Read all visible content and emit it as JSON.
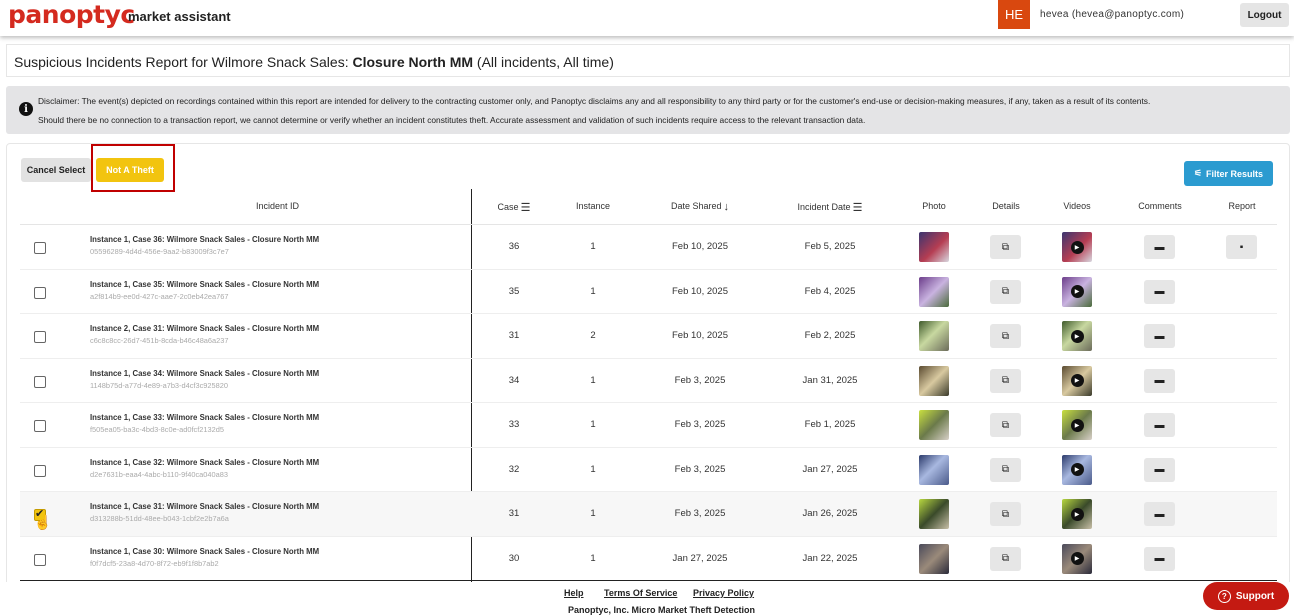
{
  "app": {
    "logo": "panoptyc",
    "tagline": "market assistant",
    "avatar_initials": "HE",
    "user": "hevea (hevea@panoptyc.com)",
    "logout": "Logout"
  },
  "report": {
    "prefix": "Suspicious Incidents Report for Wilmore Snack Sales: ",
    "location": "Closure North MM",
    "suffix": " (All incidents, All time)"
  },
  "disclaimer": {
    "line1": "Disclaimer: The event(s) depicted on recordings contained within this report are intended for delivery to the contracting customer only, and Panoptyc disclaims any and all responsibility to any third party or for the customer's end-use or decision-making measures, if any, taken as a result of its contents.",
    "line2": "Should there be no connection to a transaction report, we cannot determine or verify whether an incident constitutes theft. Accurate assessment and validation of such incidents require access to the relevant transaction data."
  },
  "toolbar": {
    "cancel_select": "Cancel Select",
    "not_a_theft": "Not A Theft",
    "filter_results": "Filter Results"
  },
  "columns": {
    "incident_id": "Incident ID",
    "case": "Case",
    "instance": "Instance",
    "date_shared": "Date Shared",
    "incident_date": "Incident Date",
    "photo": "Photo",
    "details": "Details",
    "videos": "Videos",
    "comments": "Comments",
    "report": "Report"
  },
  "rows": [
    {
      "title": "Instance 1, Case 36: Wilmore Snack Sales - Closure North MM",
      "uuid": "05596289-4d4d-456e-9aa2-b83009f3c7e7",
      "case": "36",
      "instance": "1",
      "date_shared": "Feb 10, 2025",
      "incident_date": "Feb 5, 2025",
      "checked": false,
      "has_report": true
    },
    {
      "title": "Instance 1, Case 35: Wilmore Snack Sales - Closure North MM",
      "uuid": "a2f814b9-ee0d-427c-aae7-2c0eb42ea767",
      "case": "35",
      "instance": "1",
      "date_shared": "Feb 10, 2025",
      "incident_date": "Feb 4, 2025",
      "checked": false,
      "has_report": false
    },
    {
      "title": "Instance 2, Case 31: Wilmore Snack Sales - Closure North MM",
      "uuid": "c6c8c8cc-26d7-451b-8cda-b46c48a6a237",
      "case": "31",
      "instance": "2",
      "date_shared": "Feb 10, 2025",
      "incident_date": "Feb 2, 2025",
      "checked": false,
      "has_report": false
    },
    {
      "title": "Instance 1, Case 34: Wilmore Snack Sales - Closure North MM",
      "uuid": "1148b75d-a77d-4e89-a7b3-d4cf3c925820",
      "case": "34",
      "instance": "1",
      "date_shared": "Feb 3, 2025",
      "incident_date": "Jan 31, 2025",
      "checked": false,
      "has_report": false
    },
    {
      "title": "Instance 1, Case 33: Wilmore Snack Sales - Closure North MM",
      "uuid": "f505ea05-ba3c-4bd3-8c0e-ad0fcf2132d5",
      "case": "33",
      "instance": "1",
      "date_shared": "Feb 3, 2025",
      "incident_date": "Feb 1, 2025",
      "checked": false,
      "has_report": false
    },
    {
      "title": "Instance 1, Case 32: Wilmore Snack Sales - Closure North MM",
      "uuid": "d2e7631b-eaa4-4abc-b110-9f40ca040a83",
      "case": "32",
      "instance": "1",
      "date_shared": "Feb 3, 2025",
      "incident_date": "Jan 27, 2025",
      "checked": false,
      "has_report": false
    },
    {
      "title": "Instance 1, Case 31: Wilmore Snack Sales - Closure North MM",
      "uuid": "d313288b-51dd-48ee-b043-1cbf2e2b7a6a",
      "case": "31",
      "instance": "1",
      "date_shared": "Feb 3, 2025",
      "incident_date": "Jan 26, 2025",
      "checked": true,
      "has_report": false
    },
    {
      "title": "Instance 1, Case 30: Wilmore Snack Sales - Closure North MM",
      "uuid": "f0f7dcf5-23a8-4d70-8f72-eb9f1f8b7ab2",
      "case": "30",
      "instance": "1",
      "date_shared": "Jan 27, 2025",
      "incident_date": "Jan 22, 2025",
      "checked": false,
      "has_report": false
    }
  ],
  "footer": {
    "help": "Help",
    "terms": "Terms Of Service",
    "privacy": "Privacy Policy",
    "copyright": "Panoptyc, Inc. Micro Market Theft Detection",
    "support": "Support"
  },
  "colors": {
    "brand": "#d42a1f",
    "accent_yellow": "#f2c40f",
    "filter_blue": "#2b9bd0",
    "support_red": "#c41a12"
  },
  "icons": {
    "details": "open-external-icon",
    "comments": "comment-icon",
    "report": "report-icon",
    "video": "play-icon",
    "sort": "sort-icon",
    "sort_desc": "arrow-down-icon",
    "info": "info-icon",
    "filter": "filter-icon",
    "support": "help-circle-icon"
  }
}
